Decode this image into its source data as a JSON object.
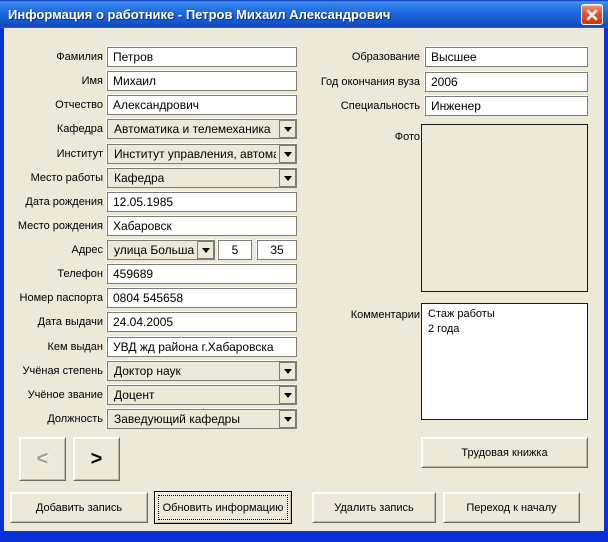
{
  "window": {
    "title": "Информация о работнике - Петров Михаил Александрович"
  },
  "colors": {
    "titlebar_blue": "#1d66dd",
    "window_border_blue": "#0831D9",
    "dialog_bg": "#ECE9D8",
    "close_button_red": "#d94a2b"
  },
  "left_fields": [
    {
      "label": "Фамилия",
      "value": "Петров",
      "type": "text"
    },
    {
      "label": "Имя",
      "value": "Михаил",
      "type": "text"
    },
    {
      "label": "Отчество",
      "value": "Александрович",
      "type": "text"
    },
    {
      "label": "Кафедра",
      "value": "Автоматика и телемеханика",
      "type": "combo"
    },
    {
      "label": "Институт",
      "value": "Институт управления, автомат",
      "type": "combo"
    },
    {
      "label": "Место работы",
      "value": "Кафедра",
      "type": "combo"
    },
    {
      "label": "Дата рождения",
      "value": "12.05.1985",
      "type": "text"
    },
    {
      "label": "Место рождения",
      "value": "Хабаровск",
      "type": "text"
    },
    {
      "label": "Телефон",
      "value": "459689",
      "type": "text"
    },
    {
      "label": "Номер паспорта",
      "value": "0804 545658",
      "type": "text"
    },
    {
      "label": "Дата выдачи",
      "value": "24.04.2005",
      "type": "text"
    },
    {
      "label": "Кем выдан",
      "value": "УВД жд района г.Хабаровска",
      "type": "text"
    },
    {
      "label": "Учёная степень",
      "value": "Доктор наук",
      "type": "combo"
    },
    {
      "label": "Учёное звание",
      "value": "Доцент",
      "type": "combo"
    },
    {
      "label": "Должность",
      "value": "Заведующий кафедры",
      "type": "combo"
    }
  ],
  "address": {
    "label": "Адрес",
    "street": "улица Большая",
    "house": "5",
    "apartment": "35"
  },
  "right_fields": [
    {
      "label": "Образование",
      "value": "Высшее"
    },
    {
      "label": "Год окончания вуза",
      "value": "2006"
    },
    {
      "label": "Специальность",
      "value": "Инженер"
    }
  ],
  "photo": {
    "label": "Фото"
  },
  "comments": {
    "label": "Комментарии",
    "value": "Стаж работы\n2 года"
  },
  "nav": {
    "prev_label": "<",
    "next_label": ">"
  },
  "buttons": {
    "work_record": "Трудовая книжка",
    "add": "Добавить запись",
    "update": "Обновить информацию",
    "delete": "Удалить запись",
    "go_start": "Переход к началу"
  }
}
